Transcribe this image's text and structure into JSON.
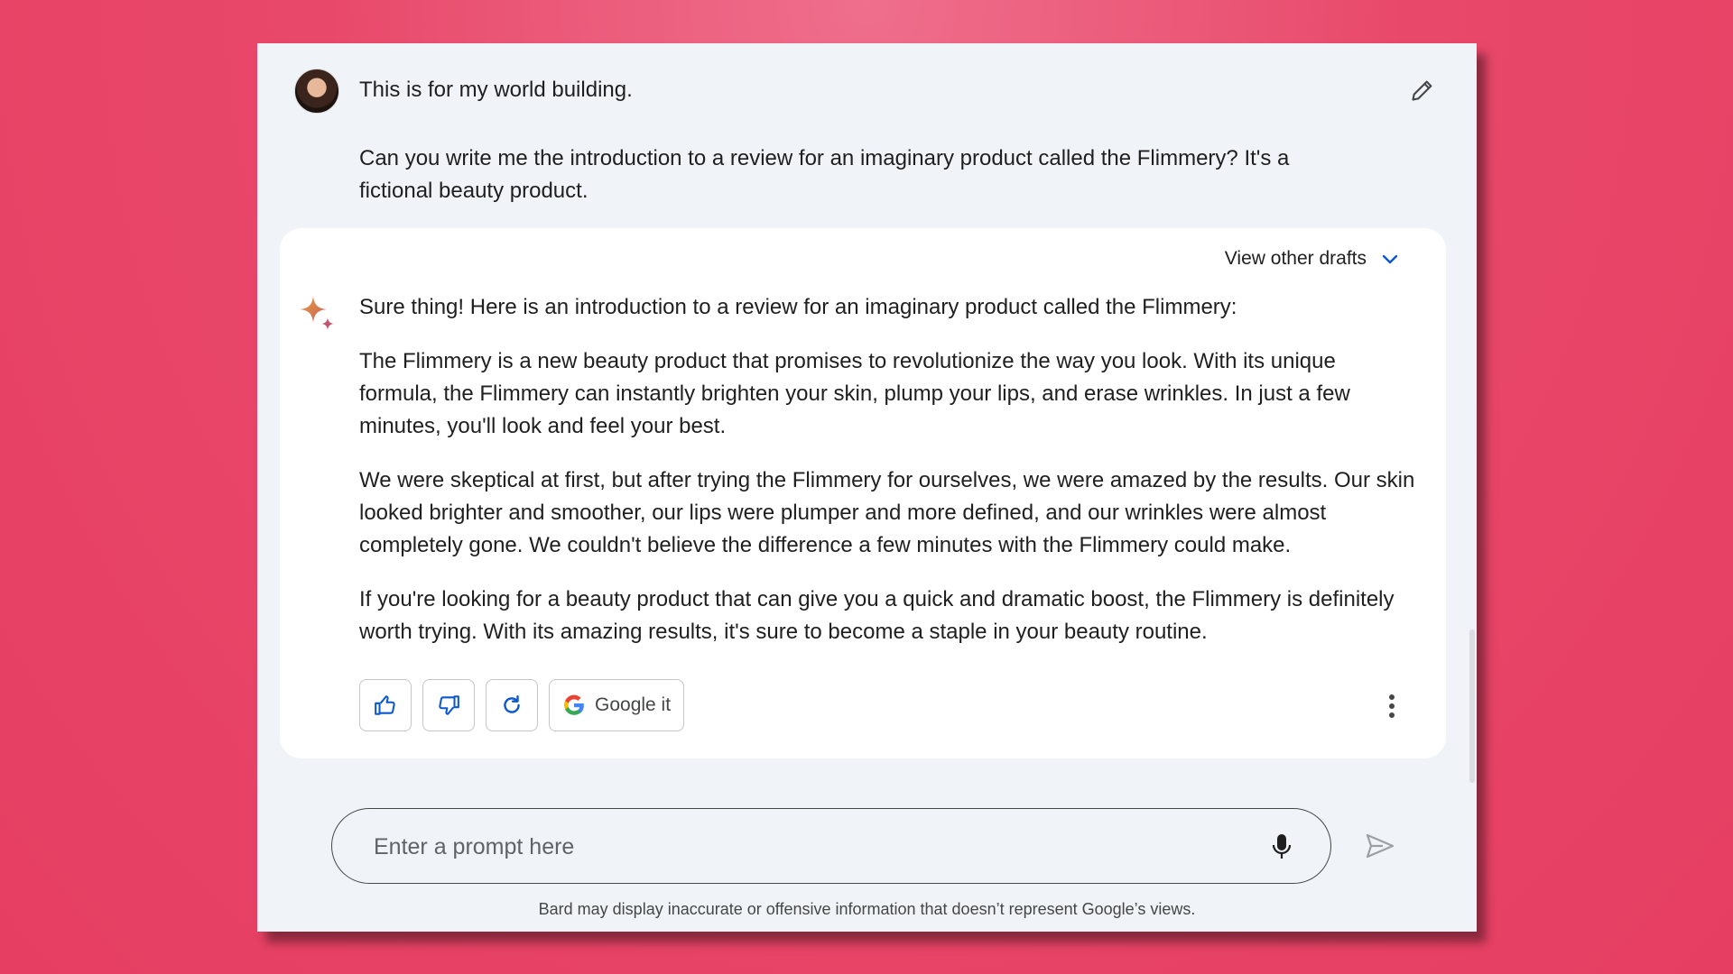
{
  "prompt": {
    "line1": "This is for my world building.",
    "line2": "Can you write me the introduction to a review for an imaginary product called the Flimmery? It's a fictional beauty product."
  },
  "response": {
    "drafts_label": "View other drafts",
    "paragraphs": [
      "Sure thing! Here is an introduction to a review for an imaginary product called the Flimmery:",
      "The Flimmery is a new beauty product that promises to revolutionize the way you look. With its unique formula, the Flimmery can instantly brighten your skin, plump your lips, and erase wrinkles. In just a few minutes, you'll look and feel your best.",
      "We were skeptical at first, but after trying the Flimmery for ourselves, we were amazed by the results. Our skin looked brighter and smoother, our lips were plumper and more defined, and our wrinkles were almost completely gone. We couldn't believe the difference a few minutes with the Flimmery could make.",
      "If you're looking for a beauty product that can give you a quick and dramatic boost, the Flimmery is definitely worth trying. With its amazing results, it's sure to become a staple in your beauty routine."
    ],
    "actions": {
      "google_label": "Google it"
    }
  },
  "input": {
    "placeholder": "Enter a prompt here",
    "value": ""
  },
  "disclaimer": "Bard may display inaccurate or offensive information that doesn’t represent Google’s views.",
  "icons": {
    "edit": "pencil-icon",
    "drafts": "chevron-down-icon",
    "bard": "sparkle-icon",
    "like": "thumbs-up-icon",
    "dislike": "thumbs-down-icon",
    "regenerate": "refresh-icon",
    "google": "google-g-icon",
    "more": "more-vertical-icon",
    "mic": "microphone-icon",
    "send": "send-icon"
  },
  "colors": {
    "background": "#e8486a",
    "window": "#f0f4f9",
    "card": "#ffffff",
    "accent": "#0b57d0"
  }
}
